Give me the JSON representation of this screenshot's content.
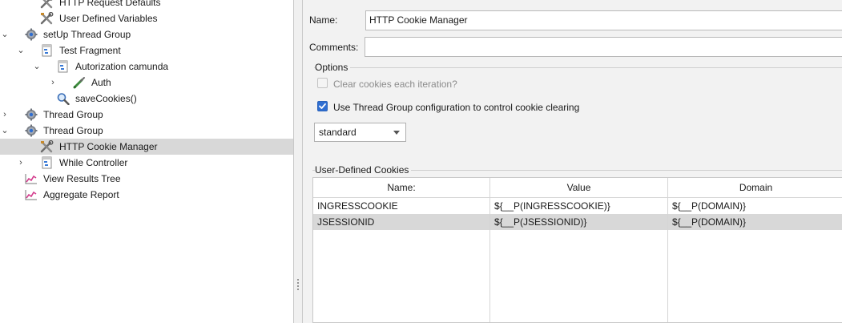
{
  "tree": {
    "items": [
      {
        "label": "HTTP Request Defaults",
        "icon": "wrench-icon",
        "toggle": ""
      },
      {
        "label": "User Defined Variables",
        "icon": "wrench-icon",
        "toggle": ""
      },
      {
        "label": "setUp Thread Group",
        "icon": "gear-icon",
        "toggle": "⌄"
      },
      {
        "label": "Test Fragment",
        "icon": "fragment-icon",
        "toggle": "⌄"
      },
      {
        "label": "Autorization camunda",
        "icon": "fragment-icon",
        "toggle": "⌄"
      },
      {
        "label": "Auth",
        "icon": "sampler-icon",
        "toggle": "›"
      },
      {
        "label": "saveCookies()",
        "icon": "magnifier-icon",
        "toggle": ""
      },
      {
        "label": "Thread Group",
        "icon": "gear-icon",
        "toggle": "›"
      },
      {
        "label": "Thread Group",
        "icon": "gear-icon",
        "toggle": "⌄"
      },
      {
        "label": "HTTP Cookie Manager",
        "icon": "wrench-icon",
        "toggle": ""
      },
      {
        "label": "While Controller",
        "icon": "fragment-icon",
        "toggle": "›"
      },
      {
        "label": "View Results Tree",
        "icon": "graph-icon",
        "toggle": ""
      },
      {
        "label": "Aggregate Report",
        "icon": "graph-icon",
        "toggle": ""
      }
    ]
  },
  "form": {
    "name_label": "Name:",
    "name_value": "HTTP Cookie Manager",
    "comments_label": "Comments:",
    "comments_value": ""
  },
  "options": {
    "title": "Options",
    "clear_cookies_label": "Clear cookies each iteration?",
    "clear_cookies_checked": false,
    "use_thread_group_label": "Use Thread Group configuration to control cookie clearing",
    "use_thread_group_checked": true,
    "policy_value": "standard"
  },
  "cookies": {
    "title": "User-Defined Cookies",
    "columns": [
      "Name:",
      "Value",
      "Domain"
    ],
    "rows": [
      {
        "name": "INGRESSCOOKIE",
        "value": "${__P(INGRESSCOOKIE)}",
        "domain": "${__P(DOMAIN)}"
      },
      {
        "name": "JSESSIONID",
        "value": "${__P(JSESSIONID)}",
        "domain": "${__P(DOMAIN)}"
      }
    ]
  },
  "colors": {
    "accent": "#2f6ed1",
    "selection": "#d8d8d8",
    "panel": "#f2f2f2"
  }
}
